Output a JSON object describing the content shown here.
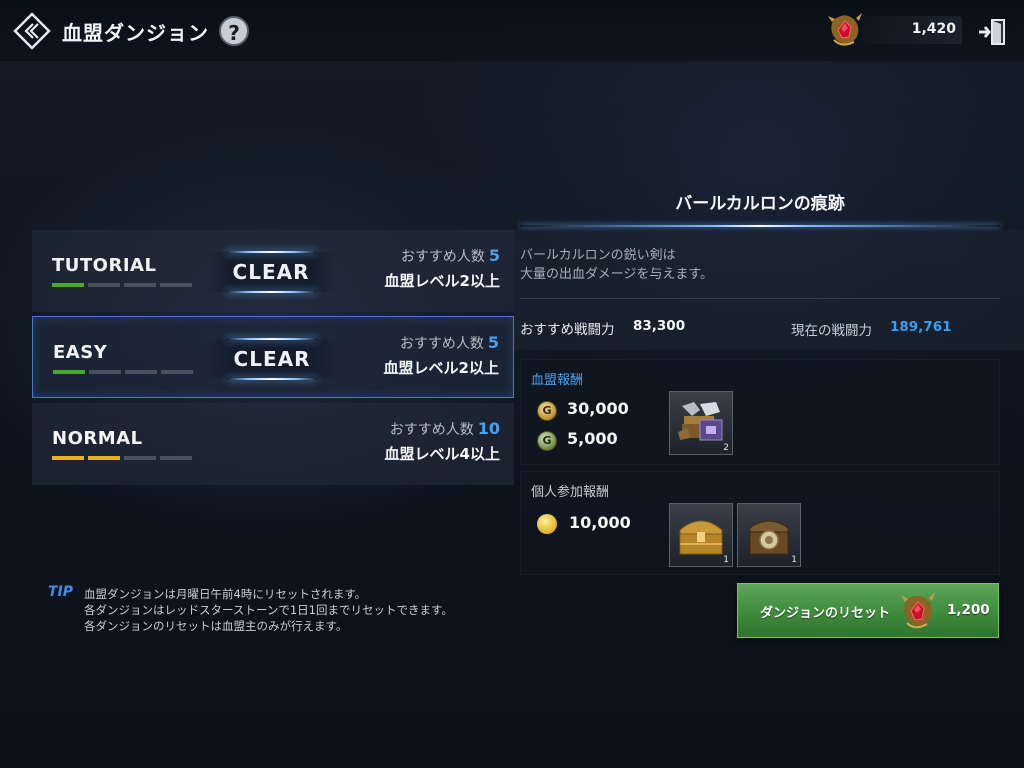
{
  "header": {
    "title": "血盟ダンジョン",
    "help_label": "?",
    "currency_amount": "1,420",
    "currency_icon": "red-star-stone-icon",
    "back_icon": "double-chevron-left-icon",
    "exit_icon": "exit-door-icon"
  },
  "difficulties": [
    {
      "name": "TUTORIAL",
      "status": "CLEAR",
      "rec_label": "おすすめ人数",
      "rec_count": "5",
      "level_req": "血盟レベル2以上",
      "bar_color": "green",
      "bars_filled": 1,
      "bars_total": 4
    },
    {
      "name": "EASY",
      "status": "CLEAR",
      "rec_label": "おすすめ人数",
      "rec_count": "5",
      "level_req": "血盟レベル2以上",
      "bar_color": "green",
      "bars_filled": 1,
      "bars_total": 4,
      "selected": true
    },
    {
      "name": "NORMAL",
      "status": "",
      "rec_label": "おすすめ人数",
      "rec_count": "10",
      "level_req": "血盟レベル4以上",
      "bar_color": "yellow",
      "bars_filled": 2,
      "bars_total": 4
    }
  ],
  "tip": {
    "label": "TIP",
    "lines": [
      "血盟ダンジョンは月曜日午前4時にリセットされます。",
      "各ダンジョンはレッドスターストーンで1日1回までリセットできます。",
      "各ダンジョンのリセットは血盟主のみが行えます。"
    ]
  },
  "dungeon": {
    "name": "バールカルロンの痕跡",
    "description": [
      "バールカルロンの鋭い剣は",
      "大量の出血ダメージを与えます。"
    ],
    "recommended_power_label": "おすすめ戦闘力",
    "recommended_power": "83,300",
    "current_power_label": "現在の戦闘力",
    "current_power": "189,761"
  },
  "clan_reward": {
    "title": "血盟報酬",
    "currencies": [
      {
        "icon": "clan-gold-coin-icon",
        "glyph": "G",
        "amount": "30,000"
      },
      {
        "icon": "clan-green-coin-icon",
        "glyph": "G",
        "amount": "5,000"
      }
    ],
    "items": [
      {
        "icon": "equipment-chest-icon",
        "count": "2"
      }
    ]
  },
  "personal_reward": {
    "title": "個人参加報酬",
    "currencies": [
      {
        "icon": "gold-coin-icon",
        "amount": "10,000"
      }
    ],
    "items": [
      {
        "icon": "golden-treasure-chest-icon",
        "count": "1"
      },
      {
        "icon": "bronze-treasure-chest-icon",
        "count": "1"
      }
    ]
  },
  "reset_button": {
    "label": "ダンジョンのリセット",
    "cost": "1,200",
    "cost_icon": "red-star-stone-icon"
  },
  "colors": {
    "accent_blue": "#3a9ef0",
    "button_green": "#4a9646",
    "bar_green": "#4aa82c",
    "bar_yellow": "#e2b31a"
  }
}
